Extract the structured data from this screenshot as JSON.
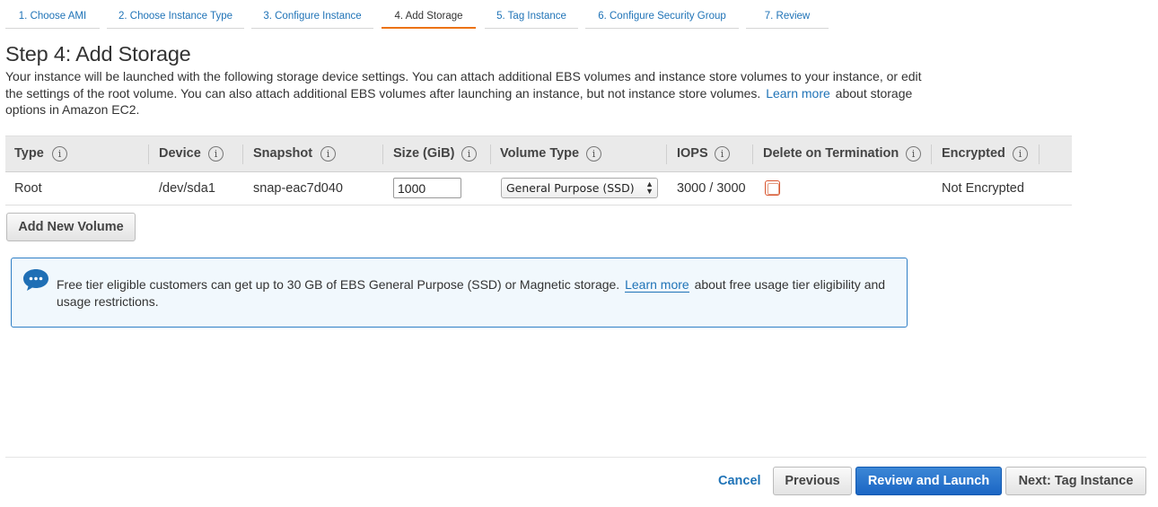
{
  "wizard": {
    "steps": [
      {
        "label": "1. Choose AMI"
      },
      {
        "label": "2. Choose Instance Type"
      },
      {
        "label": "3. Configure Instance"
      },
      {
        "label": "4. Add Storage"
      },
      {
        "label": "5. Tag Instance"
      },
      {
        "label": "6. Configure Security Group"
      },
      {
        "label": "7. Review"
      }
    ],
    "active_step": "4. Add Storage"
  },
  "page": {
    "title": "Step 4: Add Storage",
    "description_before": "Your instance will be launched with the following storage device settings. You can attach additional EBS volumes and instance store volumes to your instance, or edit the settings of the root volume. You can also attach additional EBS volumes after launching an instance, but not instance store volumes.",
    "learn_more": "Learn more",
    "description_after": "about storage options in Amazon EC2."
  },
  "table": {
    "headers": {
      "type": "Type",
      "device": "Device",
      "snapshot": "Snapshot",
      "size": "Size (GiB)",
      "volume_type": "Volume Type",
      "iops": "IOPS",
      "delete_on_termination": "Delete on Termination",
      "encrypted": "Encrypted"
    },
    "info_glyph": "i",
    "row": {
      "type": "Root",
      "device": "/dev/sda1",
      "snapshot": "snap-eac7d040",
      "size": "1000",
      "volume_type": "General Purpose (SSD)",
      "iops": "3000 / 3000",
      "delete_on_termination": false,
      "encrypted": "Not Encrypted"
    }
  },
  "add_volume_button": "Add New Volume",
  "info_box": {
    "icon": "chat-bubble-icon",
    "text_before": "Free tier eligible customers can get up to 30 GB of EBS General Purpose (SSD) or Magnetic storage.",
    "learn_more": "Learn more",
    "text_after": "about free usage tier eligibility and usage restrictions."
  },
  "footer": {
    "cancel": "Cancel",
    "previous": "Previous",
    "review_and_launch": "Review and Launch",
    "next": "Next: Tag Instance"
  },
  "colors": {
    "link": "#1f73b7",
    "active_tab_underline": "#ec7211",
    "primary_button": "#1b66c4",
    "info_border": "#2f7fc6",
    "info_background": "#f1f8fd"
  }
}
